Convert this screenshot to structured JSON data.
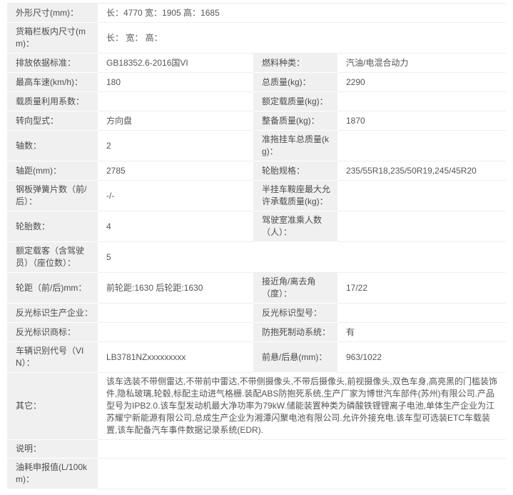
{
  "colors": {
    "label_bg": "#f0f0f0",
    "row_divider": "#efefef",
    "text": "#4a4a4a",
    "background": "#ffffff"
  },
  "rows": [
    {
      "label": "外形尺寸(mm)：",
      "value": "长：4770 宽：1905 高：1685"
    },
    {
      "label": "货箱栏板内尺寸(mm)：",
      "value": "长： 宽： 高："
    },
    {
      "label1": "排放依据标准：",
      "value1": "GB18352.6-2016国VI",
      "label2": "燃料种类：",
      "value2": "汽油/电混合动力"
    },
    {
      "label1": "最高车速(km/h)：",
      "value1": "180",
      "label2": "总质量(kg)：",
      "value2": "2290"
    },
    {
      "label1": "载质量利用系数：",
      "value1": "",
      "label2": "额定载质量(kg)：",
      "value2": ""
    },
    {
      "label1": "转向型式：",
      "value1": "方向盘",
      "label2": "整备质量(kg)：",
      "value2": "1870"
    },
    {
      "label1": "轴数：",
      "value1": "2",
      "label2": "准拖挂车总质量(kg)：",
      "value2": ""
    },
    {
      "label1": "轴距(mm)：",
      "value1": "2785",
      "label2": "轮胎规格：",
      "value2": "235/55R18,235/50R19,245/45R20"
    },
    {
      "label1": "钢板弹簧片数（前/后）：",
      "value1": "-/-",
      "label2": "半挂车鞍座最大允许承载质量(kg)：",
      "value2": ""
    },
    {
      "label1": "轮胎数：",
      "value1": "4",
      "label2": "驾驶室准乘人数（人）：",
      "value2": ""
    },
    {
      "label": "额定载客（含驾驶员）（座位数）：",
      "value": "5"
    },
    {
      "label1": "轮距（前/后)mm：",
      "value1": "前轮距:1630 后轮距:1630",
      "label2": "接近角/离去角（度）：",
      "value2": "17/22"
    },
    {
      "label1": "反光标识生产企业：",
      "value1": "",
      "label2": "反光标识型号：",
      "value2": ""
    },
    {
      "label1": "反光标识商标：",
      "value1": "",
      "label2": "防抱死制动系统：",
      "value2": "有"
    },
    {
      "label1": "车辆识别代号（VIN）：",
      "value1": "LB3781NZxxxxxxxxx",
      "label2": "前悬/后悬(mm)：",
      "value2": "963/1022"
    },
    {
      "label": "其它：",
      "value": "该车选装不带侧雷达,不带前中雷达,不带侧摄像头,不带后摄像头,前视摄像头,双色车身,高亮黑的门槛装饰件,隐私玻璃,轮毂,标配主动进气格栅.装配ABS防抱死系统,生产厂家为博世汽车部件(苏州)有限公司.产品型号为IPB2.0.该车型发动机最大净功率为79kW.储能装置种类为磷酸铁锂锂离子电池,单体生产企业为江苏耀宁新能源有限公司,总成生产企业为湘潭闪聚电池有限公司.允许外接充电.该车型可选装ETC车载装置,该车配备汽车事件数据记录系统(EDR)."
    },
    {
      "label": "说明：",
      "value": ""
    },
    {
      "label": "油耗申报值(L/100km)：",
      "value": ""
    }
  ]
}
